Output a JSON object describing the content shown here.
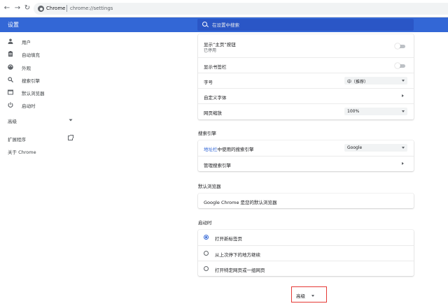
{
  "browser": {
    "site_label": "Chrome",
    "url": "chrome://settings"
  },
  "header": {
    "title": "设置",
    "search_placeholder": "在设置中搜索"
  },
  "sidebar": {
    "items": [
      {
        "label": "用户",
        "icon": "person-icon"
      },
      {
        "label": "自动填充",
        "icon": "clipboard-icon"
      },
      {
        "label": "外观",
        "icon": "palette-icon"
      },
      {
        "label": "搜索引擎",
        "icon": "search-icon"
      },
      {
        "label": "默认浏览器",
        "icon": "browser-icon"
      },
      {
        "label": "启动时",
        "icon": "power-icon"
      }
    ],
    "advanced": "高级",
    "extensions": "扩展程序",
    "about": "关于 Chrome"
  },
  "appearance": {
    "home_button_label": "显示“主页”按钮",
    "home_button_sub": "已停用",
    "bookmarks_bar_label": "显示书签栏",
    "font_size_label": "字号",
    "font_size_value": "中（推荐）",
    "custom_fonts_label": "自定义字体",
    "page_zoom_label": "网页缩放",
    "page_zoom_value": "100%"
  },
  "search_engine": {
    "section_title": "搜索引擎",
    "address_bar_link": "地址栏",
    "address_bar_label": "中使用的搜索引擎",
    "engine_value": "Google",
    "manage_label": "管理搜索引擎"
  },
  "default_browser": {
    "section_title": "默认浏览器",
    "status": "Google Chrome 是您的默认浏览器"
  },
  "startup": {
    "section_title": "启动时",
    "options": [
      {
        "label": "打开新标签页",
        "selected": true
      },
      {
        "label": "从上次停下的地方继续",
        "selected": false
      },
      {
        "label": "打开特定网页或一组网页",
        "selected": false
      }
    ]
  },
  "advanced_button": {
    "label": "高级"
  }
}
